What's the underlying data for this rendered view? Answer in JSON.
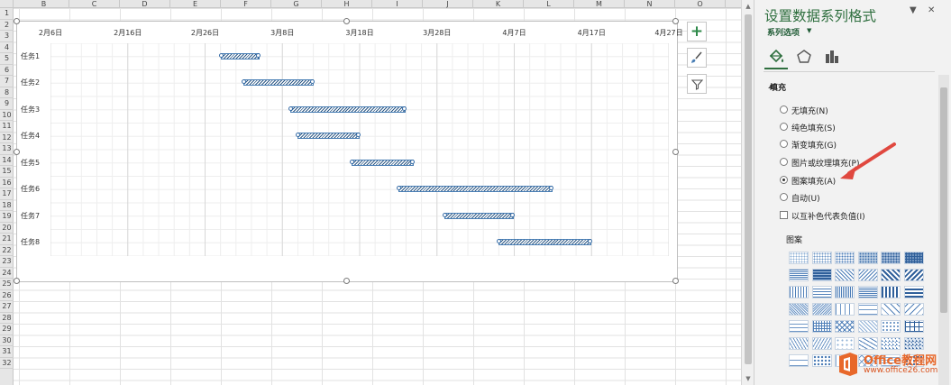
{
  "sheet": {
    "columns": [
      "B",
      "C",
      "D",
      "E",
      "F",
      "G",
      "H",
      "I",
      "J",
      "K",
      "L",
      "M",
      "N",
      "O"
    ],
    "rows": [
      "1",
      "2",
      "3",
      "4",
      "5",
      "6",
      "7",
      "8",
      "9",
      "10",
      "11",
      "12",
      "13",
      "14",
      "15",
      "16",
      "17",
      "18",
      "19",
      "20",
      "21",
      "22",
      "23",
      "24",
      "25",
      "26",
      "27",
      "28",
      "29",
      "30",
      "31",
      "32"
    ]
  },
  "chart_data": {
    "type": "bar",
    "orientation": "horizontal",
    "subtype": "gantt",
    "categories": [
      "任务1",
      "任务2",
      "任务3",
      "任务4",
      "任务5",
      "任务6",
      "任务7",
      "任务8"
    ],
    "x_axis_position": "top",
    "xtick_labels": [
      "2月6日",
      "2月16日",
      "2月26日",
      "3月8日",
      "3月18日",
      "3月28日",
      "4月7日",
      "4月17日",
      "4月27日"
    ],
    "xlim": [
      "2月6日",
      "4月27日"
    ],
    "series": [
      {
        "start": [
          "2月28日",
          "3月3日",
          "3月9日",
          "3月10日",
          "3月17日",
          "3月23日",
          "3月29日",
          "4月5日"
        ],
        "end": [
          "3月5日",
          "3月12日",
          "3月24日",
          "3月18日",
          "3月25日",
          "4月12日",
          "4月7日",
          "4月17日"
        ],
        "fill": "pattern-wide-upward-diagonal",
        "color": "#2f5a86"
      }
    ],
    "grid": true,
    "legend": "none"
  },
  "pane": {
    "title": "设置数据系列格式",
    "series_options_label": "系列选项",
    "fill_section_label": "填充",
    "fill_options": [
      {
        "label": "无填充(N)",
        "selected": false
      },
      {
        "label": "纯色填充(S)",
        "selected": false
      },
      {
        "label": "渐变填充(G)",
        "selected": false
      },
      {
        "label": "图片或纹理填充(P)",
        "selected": false
      },
      {
        "label": "图案填充(A)",
        "selected": true
      },
      {
        "label": "自动(U)",
        "selected": false
      }
    ],
    "invert_label": "以互补色代表负值(I)",
    "pattern_label": "图案",
    "close_symbol": "✕",
    "dropdown_symbol": "▼"
  },
  "colors": {
    "pane_title": "#2f6f3f",
    "bar_stroke": "#4a7fb5",
    "bar_pattern": "#2f5a86",
    "annotation_arrow": "#e0483f"
  },
  "watermark": {
    "title": "Office教程网",
    "url": "www.office26.com"
  },
  "icons": {
    "chart_elements": "plus-icon",
    "chart_styles": "brush-icon",
    "chart_filters": "filter-icon",
    "fill_line_tab": "paint-bucket-icon",
    "effects_tab": "pentagon-icon",
    "series_options_tab": "bar-chart-icon"
  }
}
